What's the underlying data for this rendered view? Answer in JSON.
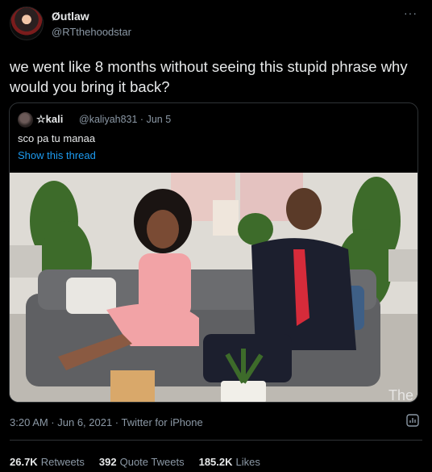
{
  "author": {
    "name": "Øutlaw",
    "handle": "@RTthehoodstar"
  },
  "more_glyph": "···",
  "tweet": {
    "text": "we went like 8 months without seeing this stupid phrase why would you bring it back?"
  },
  "quote": {
    "name": "☆kali",
    "handle_date": "@kaliyah831 · Jun 5",
    "text": "sco pa tu manaa",
    "show_thread": "Show this thread"
  },
  "meta": {
    "timestamp": "3:20 AM · Jun 6, 2021 · Twitter for iPhone"
  },
  "stats": {
    "retweets_count": "26.7K",
    "retweets_label": "Retweets",
    "quotes_count": "392",
    "quotes_label": "Quote Tweets",
    "likes_count": "185.2K",
    "likes_label": "Likes"
  },
  "colors": {
    "background": "#000000",
    "link": "#1d9bf0",
    "muted": "#8b98a5",
    "text": "#e7e9ea",
    "border": "#2f3336"
  }
}
